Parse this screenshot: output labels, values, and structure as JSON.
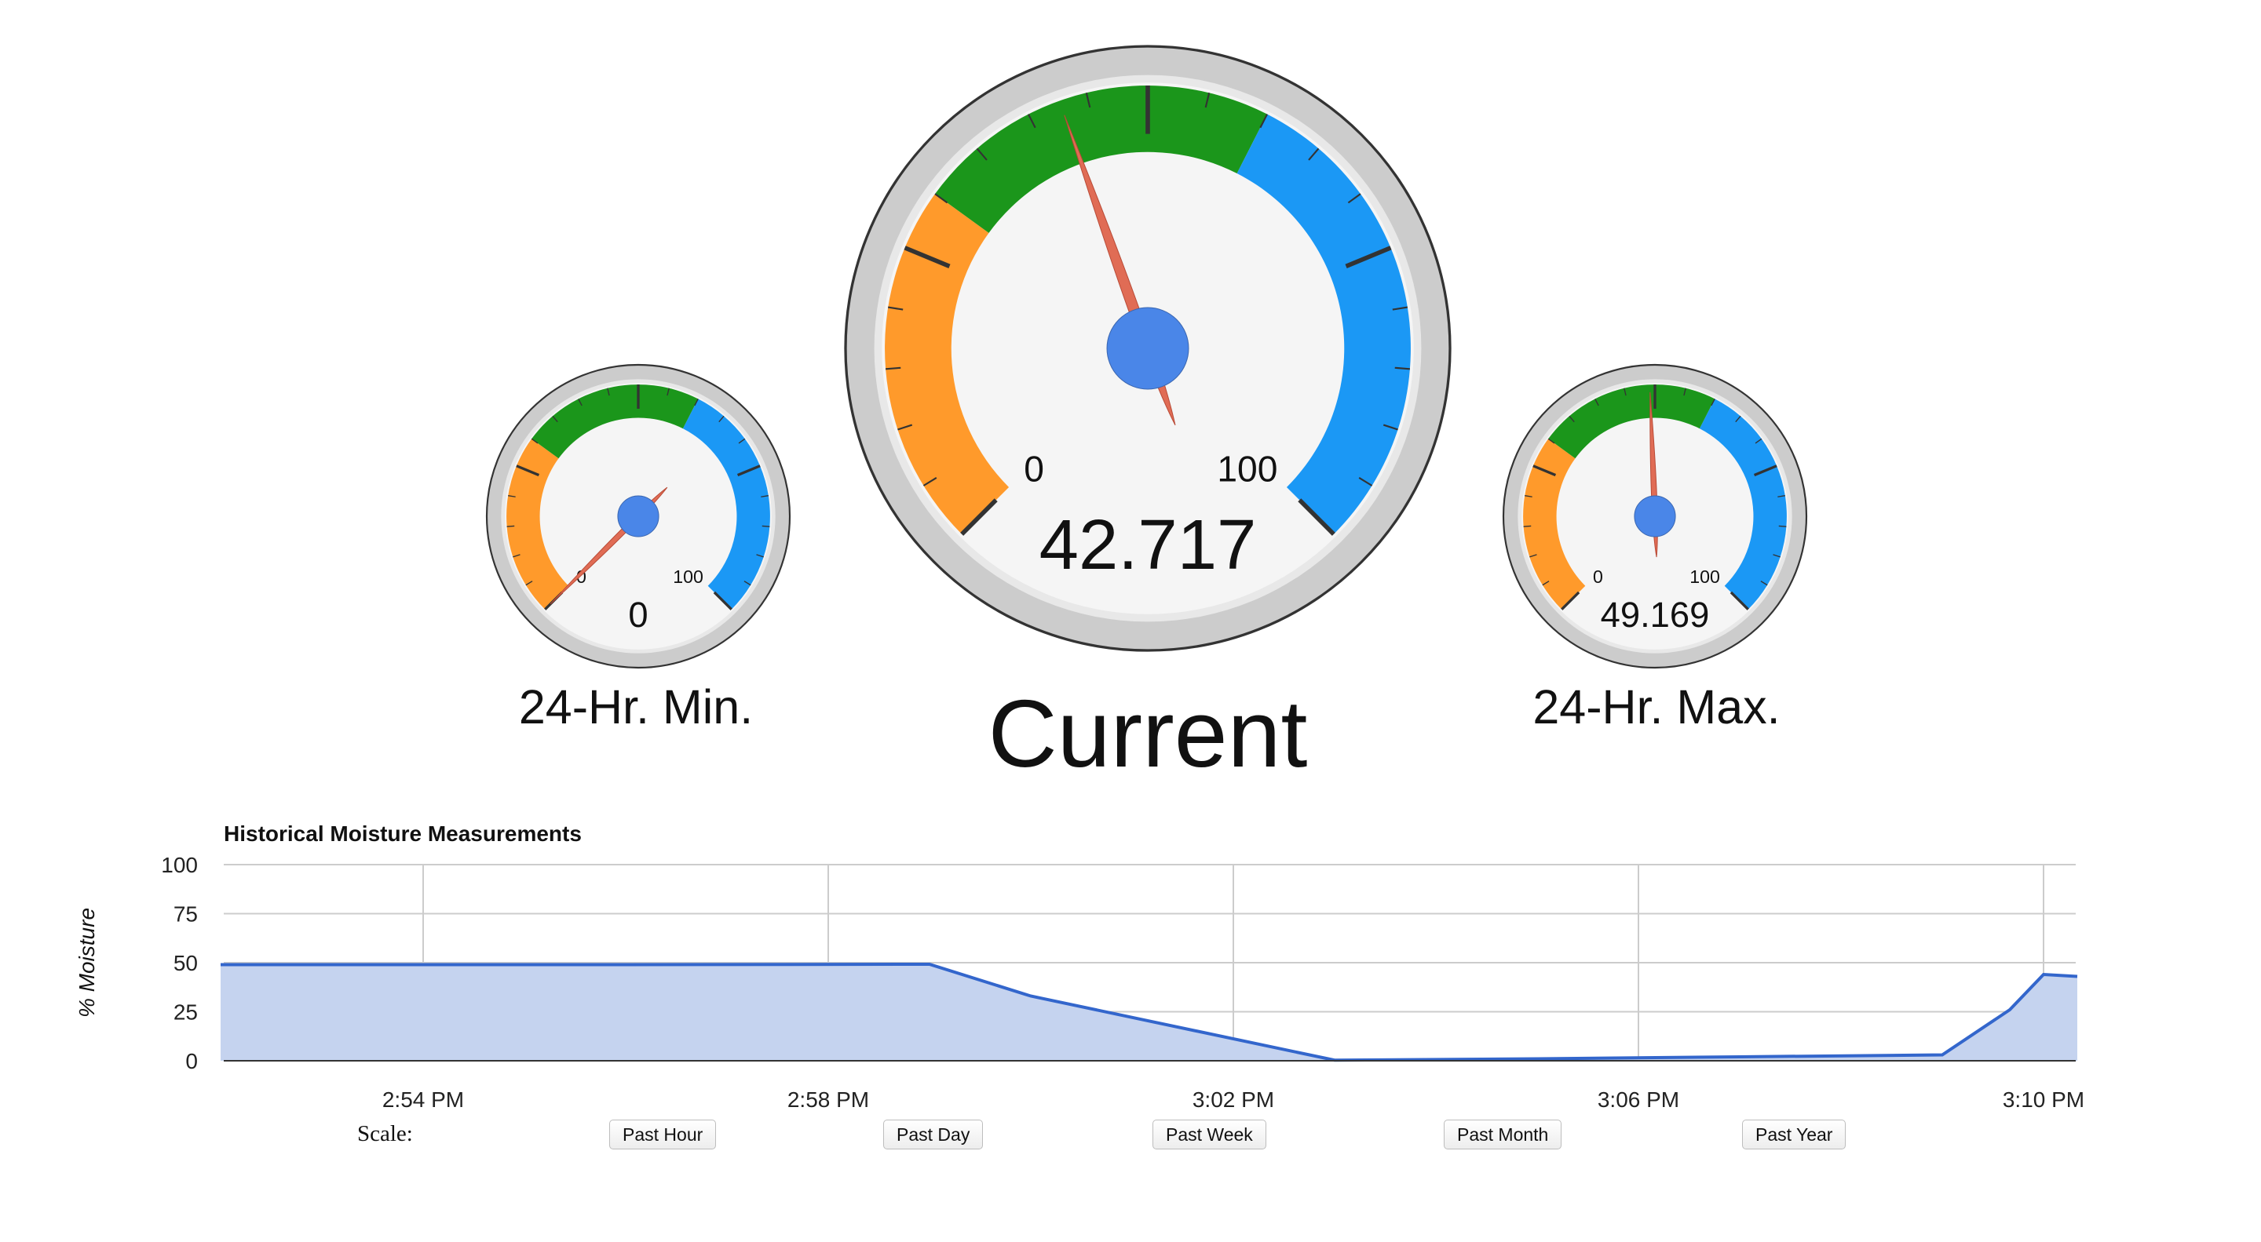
{
  "gauges": {
    "min": {
      "value": 0,
      "value_label": "0",
      "range_min_label": "0",
      "range_max_label": "100",
      "caption": "24-Hr. Min."
    },
    "current": {
      "value": 42.717,
      "value_label": "42.717",
      "range_min_label": "0",
      "range_max_label": "100",
      "caption": "Current"
    },
    "max": {
      "value": 49.169,
      "value_label": "49.169",
      "range_min_label": "0",
      "range_max_label": "100",
      "caption": "24-Hr. Max."
    },
    "bands": [
      {
        "from": 0,
        "to": 30,
        "color": "#ff9a2b"
      },
      {
        "from": 30,
        "to": 60,
        "color": "#1b961b"
      },
      {
        "from": 60,
        "to": 100,
        "color": "#1b98f5"
      }
    ],
    "needle_color": "#e06c55",
    "hub_color": "#4a86e8"
  },
  "chart_data": {
    "type": "area",
    "title": "Historical Moisture Measurements",
    "ylabel": "% Moisture",
    "xlabel": "",
    "ylim": [
      0,
      100
    ],
    "yticks": [
      "0",
      "25",
      "50",
      "75",
      "100"
    ],
    "xticks": [
      "2:54 PM",
      "2:58 PM",
      "3:02 PM",
      "3:06 PM",
      "3:10 PM"
    ],
    "grid": true,
    "series": [
      {
        "color": "#3366cc",
        "fill": "#c5d3ef",
        "points": [
          {
            "x": "2:52 PM",
            "y": 49
          },
          {
            "x": "2:56 PM",
            "y": 49
          },
          {
            "x": "2:59 PM",
            "y": 49.2
          },
          {
            "x": "3:00 PM",
            "y": 33
          },
          {
            "x": "3:03 PM",
            "y": 0.3
          },
          {
            "x": "3:05 PM",
            "y": 1
          },
          {
            "x": "3:07 PM",
            "y": 2
          },
          {
            "x": "3:09 PM",
            "y": 3
          },
          {
            "x": "3:09:40 PM",
            "y": 26
          },
          {
            "x": "3:10 PM",
            "y": 44
          },
          {
            "x": "3:10:20 PM",
            "y": 43
          }
        ]
      }
    ]
  },
  "scale": {
    "label": "Scale:",
    "buttons": [
      "Past Hour",
      "Past Day",
      "Past Week",
      "Past Month",
      "Past Year"
    ]
  }
}
